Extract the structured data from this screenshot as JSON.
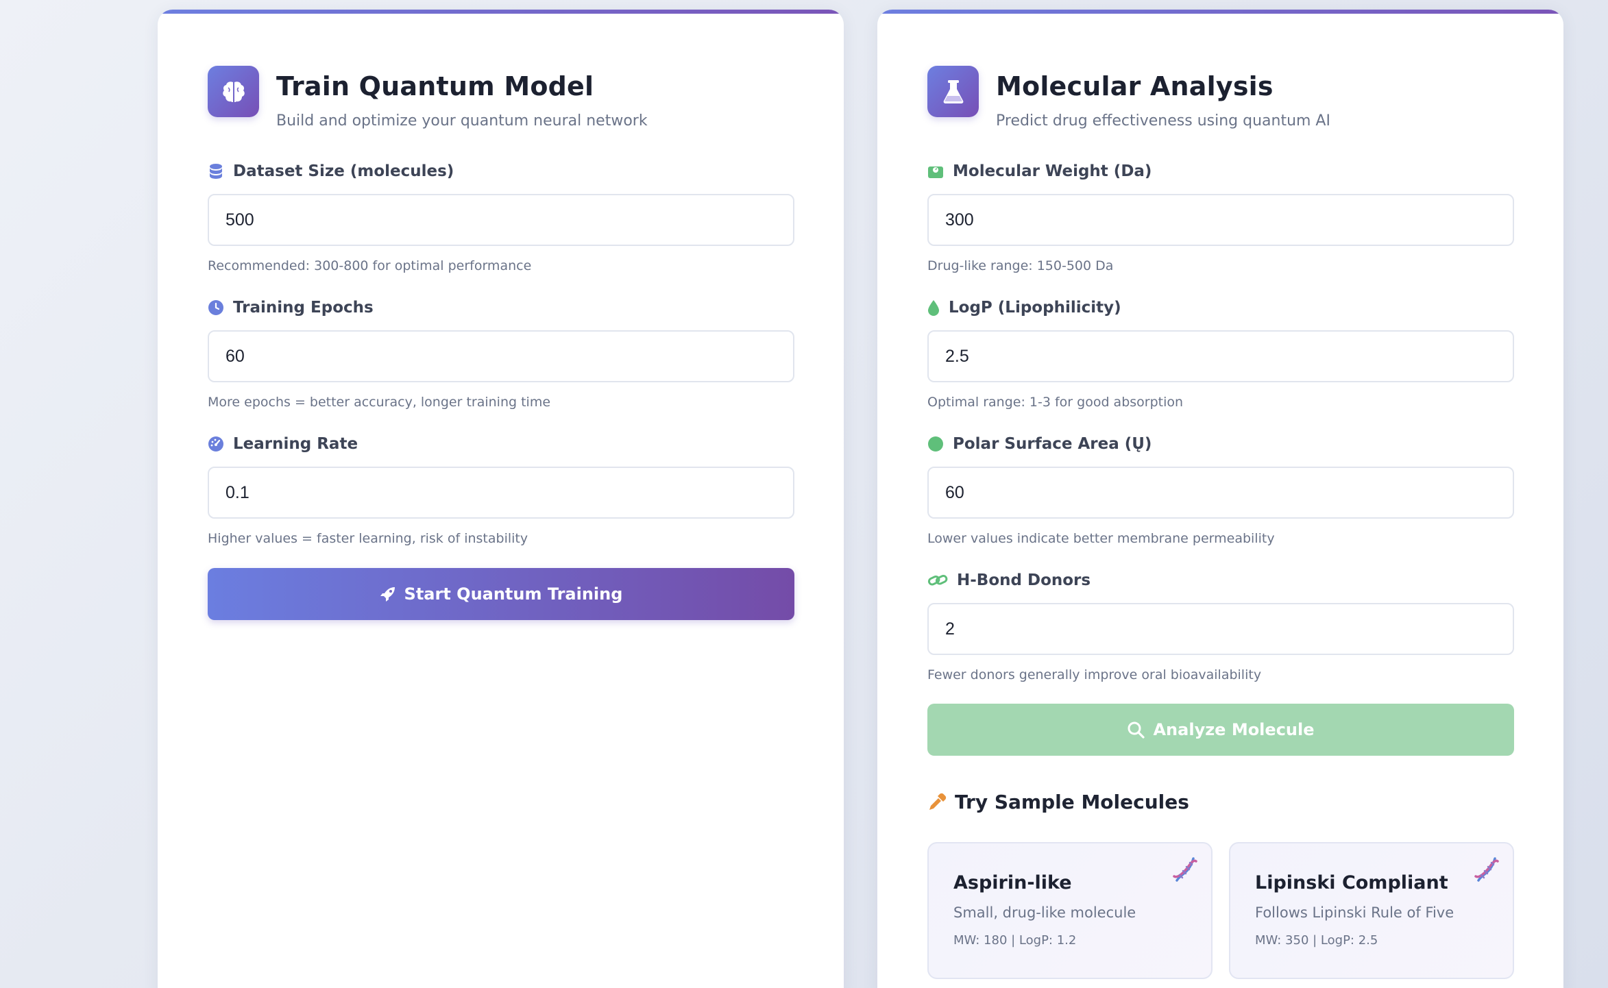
{
  "train": {
    "title": "Train Quantum Model",
    "subtitle": "Build and optimize your quantum neural network",
    "icon": "brain-icon",
    "fields": [
      {
        "label": "Dataset Size (molecules)",
        "value": "500",
        "hint": "Recommended: 300-800 for optimal performance",
        "icon": "database-icon"
      },
      {
        "label": "Training Epochs",
        "value": "60",
        "hint": "More epochs = better accuracy, longer training time",
        "icon": "clock-icon"
      },
      {
        "label": "Learning Rate",
        "value": "0.1",
        "hint": "Higher values = faster learning, risk of instability",
        "icon": "gauge-icon"
      }
    ],
    "button_label": "Start Quantum Training",
    "button_icon": "rocket-icon"
  },
  "analysis": {
    "title": "Molecular Analysis",
    "subtitle": "Predict drug effectiveness using quantum AI",
    "icon": "flask-icon",
    "fields": [
      {
        "label": "Molecular Weight (Da)",
        "value": "300",
        "hint": "Drug-like range: 150-500 Da",
        "icon": "weight-icon"
      },
      {
        "label": "LogP (Lipophilicity)",
        "value": "2.5",
        "hint": "Optimal range: 1-3 for good absorption",
        "icon": "droplet-icon"
      },
      {
        "label": "Polar Surface Area (Ų)",
        "value": "60",
        "hint": "Lower values indicate better membrane permeability",
        "icon": "circle-icon"
      },
      {
        "label": "H-Bond Donors",
        "value": "2",
        "hint": "Fewer donors generally improve oral bioavailability",
        "icon": "link-icon"
      }
    ],
    "button_label": "Analyze Molecule",
    "button_icon": "search-icon",
    "samples_title": "Try Sample Molecules",
    "samples_icon": "pipette-icon",
    "samples": [
      {
        "name": "Aspirin-like",
        "description": "Small, drug-like molecule",
        "meta": "MW: 180 | LogP: 1.2",
        "icon": "dna-icon"
      },
      {
        "name": "Lipinski Compliant",
        "description": "Follows Lipinski Rule of Five",
        "meta": "MW: 350 | LogP: 2.5",
        "icon": "dna-icon"
      }
    ]
  },
  "colors": {
    "accent_start": "#6d7fe0",
    "accent_end": "#7a55b8",
    "icon_blue": "#6a7fdc",
    "icon_green": "#5fbf7a",
    "analyze_button": "#a3d7b1",
    "pipette": "#e8923a"
  }
}
